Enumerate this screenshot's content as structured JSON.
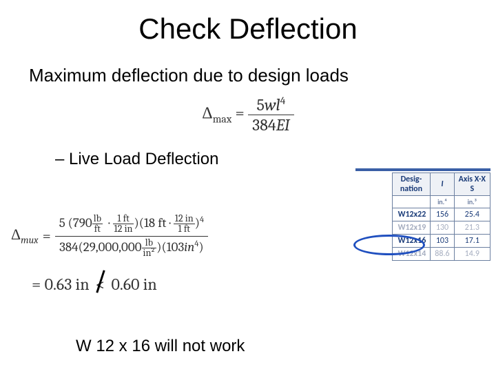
{
  "title": "Check Deflection",
  "subtitle": "Maximum deflection due to design loads",
  "formula": {
    "lhs_sym": "Δ",
    "lhs_sub": "max",
    "num_coeff": "5",
    "num_var": "wl",
    "num_exp": "4",
    "den_coeff": "384",
    "den_var": "EI"
  },
  "item_heading": "– Live Load Deflection",
  "calc": {
    "lhs_sym": "Δ",
    "lhs_sub": "mux",
    "num_coeff": "5",
    "load_val": "790",
    "load_unit_num": "lb",
    "load_unit_den": "ft",
    "conv1_num": "1 ft",
    "conv1_den": "12 in",
    "span_val": "18 ft",
    "conv2_num": "12 in",
    "conv2_den": "1 ft",
    "span_exp": "4",
    "den_coeff": "384",
    "E_val": "29,000,000",
    "E_unit_num": "lb",
    "E_unit_den": "in²",
    "I_val": "103",
    "I_unit": "in",
    "I_exp": "4"
  },
  "result": {
    "computed": "0.63 in",
    "limit": "0.60 in",
    "relation": "<"
  },
  "conclusion": "W 12 x 16  will not work",
  "table": {
    "headers": {
      "c0": "Desig-\nnation",
      "c1": "I",
      "c2": "Axis X-X\nS"
    },
    "units": {
      "c1": "in.⁴",
      "c2": "in.³"
    },
    "rows": [
      {
        "name": "W12x22",
        "I": "156",
        "S": "25.4",
        "dim": false
      },
      {
        "name": "W12x19",
        "I": "130",
        "S": "21.3",
        "dim": true
      },
      {
        "name": "W12x16",
        "I": "103",
        "S": "17.1",
        "dim": false
      },
      {
        "name": "W12x14",
        "I": "88.6",
        "S": "14.9",
        "dim": true
      }
    ]
  },
  "chart_data": {
    "type": "table",
    "title": "W-shape section properties (Axis X-X)",
    "columns": [
      "Designation",
      "I (in⁴)",
      "S (in³)"
    ],
    "rows": [
      [
        "W12x22",
        156,
        25.4
      ],
      [
        "W12x19",
        130,
        21.3
      ],
      [
        "W12x16",
        103,
        17.1
      ],
      [
        "W12x14",
        88.6,
        14.9
      ]
    ]
  }
}
